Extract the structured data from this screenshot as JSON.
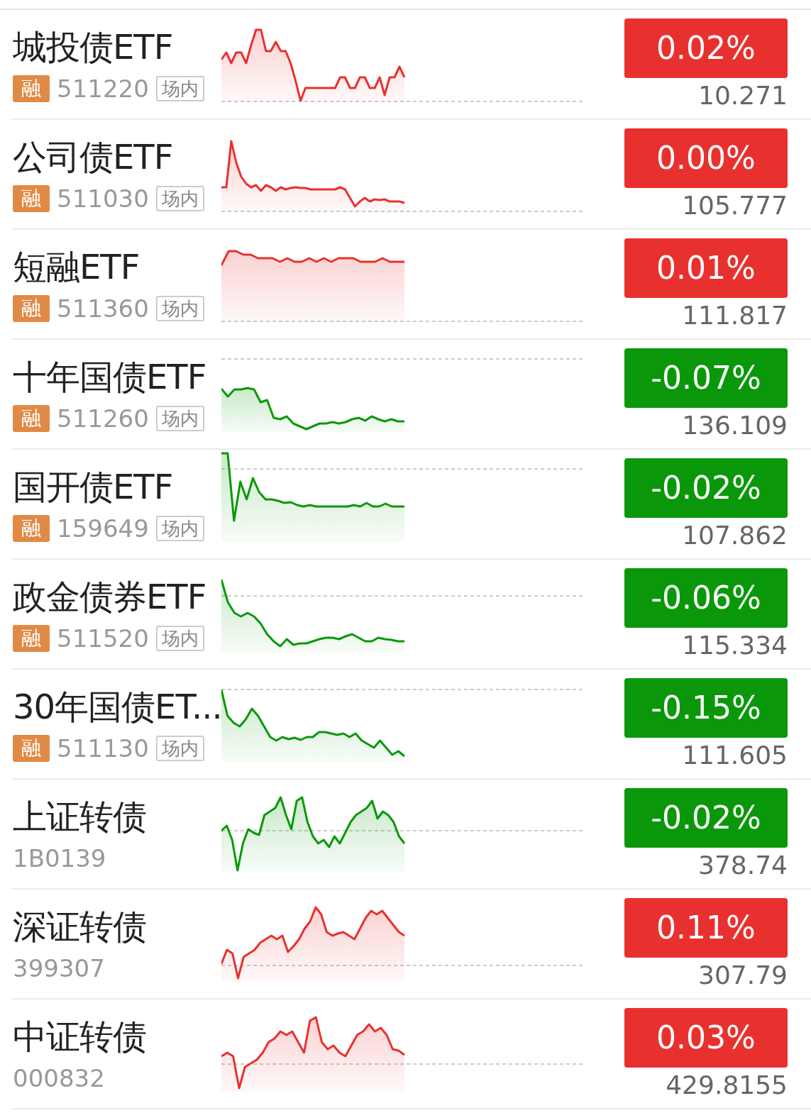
{
  "rows": [
    {
      "name": "城投债ETF",
      "margin_tag": "融",
      "code": "511220",
      "market_tag": "场内",
      "change": "0.02%",
      "color": "#e8312f",
      "price": "10.271"
    },
    {
      "name": "公司债ETF",
      "margin_tag": "融",
      "code": "511030",
      "market_tag": "场内",
      "change": "0.00%",
      "color": "#e8312f",
      "price": "105.777"
    },
    {
      "name": "短融ETF",
      "margin_tag": "融",
      "code": "511360",
      "market_tag": "场内",
      "change": "0.01%",
      "color": "#e8312f",
      "price": "111.817"
    },
    {
      "name": "十年国债ETF",
      "margin_tag": "融",
      "code": "511260",
      "market_tag": "场内",
      "change": "-0.07%",
      "color": "#0a980a",
      "price": "136.109"
    },
    {
      "name": "国开债ETF",
      "margin_tag": "融",
      "code": "159649",
      "market_tag": "场内",
      "change": "-0.02%",
      "color": "#0a980a",
      "price": "107.862"
    },
    {
      "name": "政金债券ETF",
      "margin_tag": "融",
      "code": "511520",
      "market_tag": "场内",
      "change": "-0.06%",
      "color": "#0a980a",
      "price": "115.334"
    },
    {
      "name": "30年国债ET...",
      "margin_tag": "融",
      "code": "511130",
      "market_tag": "场内",
      "change": "-0.15%",
      "color": "#0a980a",
      "price": "111.605"
    },
    {
      "name": "上证转债",
      "code": "1B0139",
      "change": "-0.02%",
      "color": "#0a980a",
      "price": "378.74"
    },
    {
      "name": "深证转债",
      "code": "399307",
      "change": "0.11%",
      "color": "#e8312f",
      "price": "307.79"
    },
    {
      "name": "中证转债",
      "code": "000832",
      "change": "0.03%",
      "color": "#e8312f",
      "price": "429.8155"
    }
  ]
}
